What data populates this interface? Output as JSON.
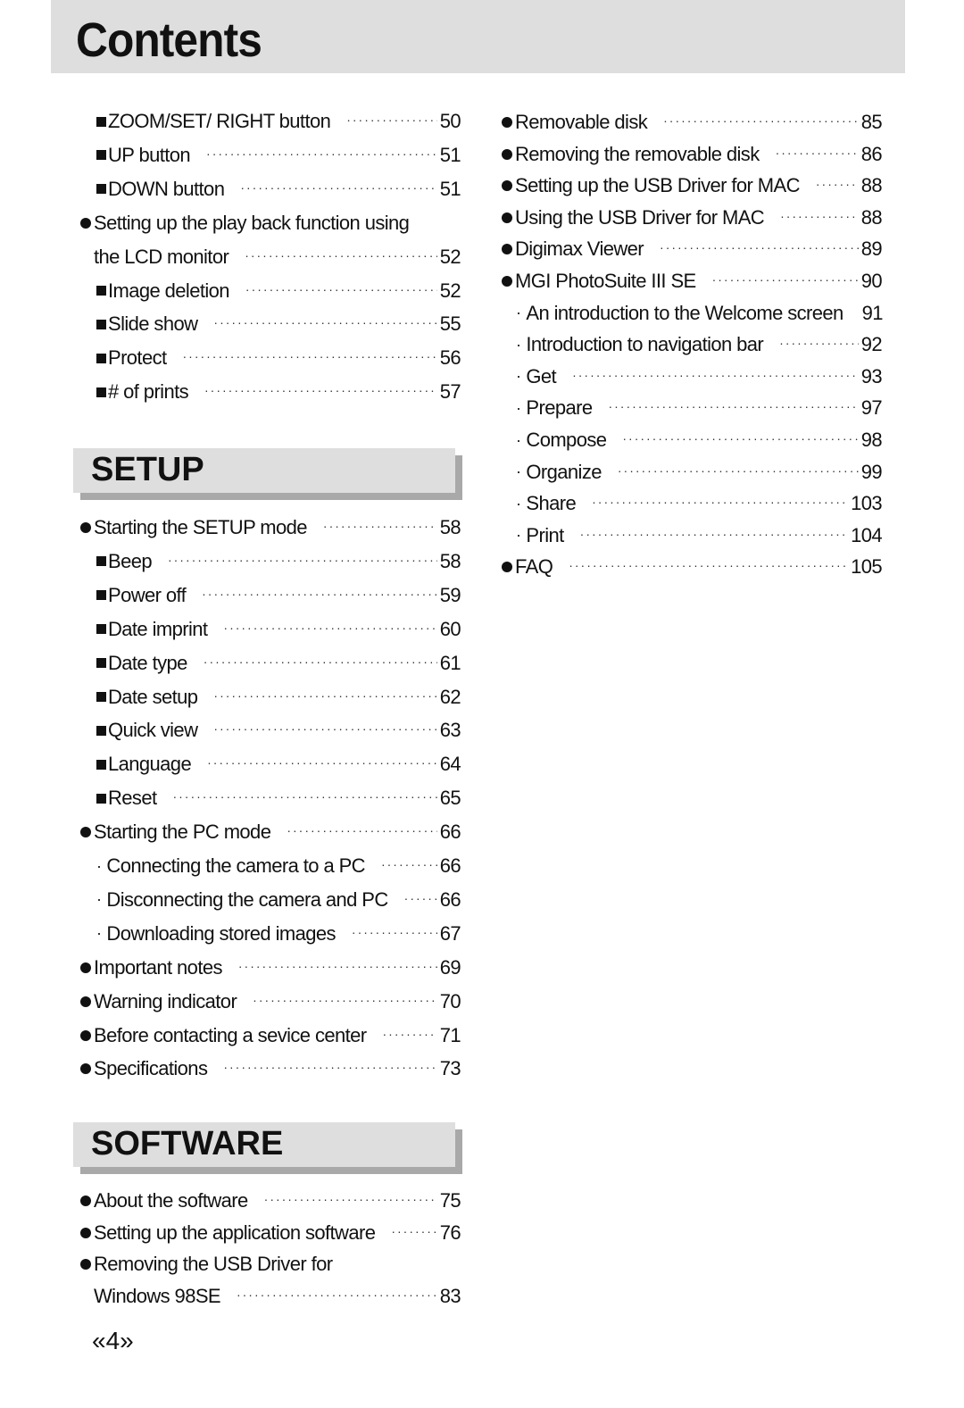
{
  "header": {
    "title": "Contents"
  },
  "left_column": {
    "entries_top": [
      {
        "bullet": "square",
        "indent": 1,
        "label": "ZOOM/SET/ RIGHT button",
        "page": "50"
      },
      {
        "bullet": "square",
        "indent": 1,
        "label": "UP  button",
        "page": "51"
      },
      {
        "bullet": "square",
        "indent": 1,
        "label": "DOWN button",
        "page": "51"
      },
      {
        "bullet": "circle",
        "indent": 0,
        "label": "Setting up the play back function using",
        "page": ""
      },
      {
        "bullet": "none",
        "indent": 0,
        "label": "the LCD monitor",
        "page": "52"
      },
      {
        "bullet": "square",
        "indent": 1,
        "label": "Image deletion",
        "page": "52"
      },
      {
        "bullet": "square",
        "indent": 1,
        "label": "Slide show",
        "page": "55"
      },
      {
        "bullet": "square",
        "indent": 1,
        "label": "Protect",
        "page": "56"
      },
      {
        "bullet": "square",
        "indent": 1,
        "label": "# of prints",
        "page": "57"
      }
    ],
    "setup_section": {
      "title": "SETUP",
      "entries": [
        {
          "bullet": "circle",
          "indent": 0,
          "label": "Starting the SETUP mode",
          "page": "58"
        },
        {
          "bullet": "square",
          "indent": 1,
          "label": "Beep",
          "page": "58"
        },
        {
          "bullet": "square",
          "indent": 1,
          "label": "Power off",
          "page": "59"
        },
        {
          "bullet": "square",
          "indent": 1,
          "label": "Date imprint",
          "page": "60"
        },
        {
          "bullet": "square",
          "indent": 1,
          "label": "Date type",
          "page": "61"
        },
        {
          "bullet": "square",
          "indent": 1,
          "label": "Date setup",
          "page": "62"
        },
        {
          "bullet": "square",
          "indent": 1,
          "label": "Quick view",
          "page": "63"
        },
        {
          "bullet": "square",
          "indent": 1,
          "label": "Language",
          "page": "64"
        },
        {
          "bullet": "square",
          "indent": 1,
          "label": "Reset",
          "page": "65"
        },
        {
          "bullet": "circle",
          "indent": 0,
          "label": "Starting the PC mode",
          "page": "66"
        },
        {
          "bullet": "dot",
          "indent": 1,
          "label": "Connecting the camera to a PC",
          "page": "66"
        },
        {
          "bullet": "dot",
          "indent": 1,
          "label": "Disconnecting the camera and PC",
          "page": "66"
        },
        {
          "bullet": "dot",
          "indent": 1,
          "label": "Downloading stored images",
          "page": "67"
        },
        {
          "bullet": "circle",
          "indent": 0,
          "label": "Important notes",
          "page": "69"
        },
        {
          "bullet": "circle",
          "indent": 0,
          "label": "Warning indicator",
          "page": "70"
        },
        {
          "bullet": "circle",
          "indent": 0,
          "label": "Before contacting a sevice center",
          "page": "71"
        },
        {
          "bullet": "circle",
          "indent": 0,
          "label": "Specifications",
          "page": "73"
        }
      ]
    },
    "software_section": {
      "title": "SOFTWARE",
      "entries": [
        {
          "bullet": "circle",
          "indent": 0,
          "label": "About the software",
          "page": "75"
        },
        {
          "bullet": "circle",
          "indent": 0,
          "label": "Setting up the application software",
          "page": "76"
        },
        {
          "bullet": "circle",
          "indent": 0,
          "label": "Removing the USB Driver for",
          "page": ""
        },
        {
          "bullet": "none",
          "indent": 0,
          "label": "Windows 98SE",
          "page": "83"
        }
      ]
    }
  },
  "right_column": {
    "entries": [
      {
        "bullet": "circle",
        "indent": 0,
        "label": "Removable disk",
        "page": "85"
      },
      {
        "bullet": "circle",
        "indent": 0,
        "label": "Removing the removable disk",
        "page": "86"
      },
      {
        "bullet": "circle",
        "indent": 0,
        "label": "Setting up the USB Driver for MAC",
        "page": "88"
      },
      {
        "bullet": "circle",
        "indent": 0,
        "label": "Using the USB Driver for MAC",
        "page": "88"
      },
      {
        "bullet": "circle",
        "indent": 0,
        "label": "Digimax Viewer",
        "page": "89"
      },
      {
        "bullet": "circle",
        "indent": 0,
        "label": "MGI PhotoSuite III SE",
        "page": "90"
      },
      {
        "bullet": "dot",
        "indent": 2,
        "label": "An introduction to the Welcome screen",
        "page": "91"
      },
      {
        "bullet": "dot",
        "indent": 2,
        "label": " Introduction to navigation bar",
        "page": "92"
      },
      {
        "bullet": "dot",
        "indent": 2,
        "label": "Get",
        "page": "93"
      },
      {
        "bullet": "dot",
        "indent": 2,
        "label": "Prepare",
        "page": "97"
      },
      {
        "bullet": "dot",
        "indent": 2,
        "label": "Compose",
        "page": "98"
      },
      {
        "bullet": "dot",
        "indent": 2,
        "label": "Organize",
        "page": "99"
      },
      {
        "bullet": "dot",
        "indent": 2,
        "label": "Share",
        "page": "103"
      },
      {
        "bullet": "dot",
        "indent": 2,
        "label": "Print",
        "page": "104"
      },
      {
        "bullet": "circle",
        "indent": 0,
        "label": "FAQ",
        "page": "105"
      }
    ]
  },
  "footer": {
    "page_number": "4",
    "page_left_mark": "«",
    "page_right_mark": "»"
  }
}
